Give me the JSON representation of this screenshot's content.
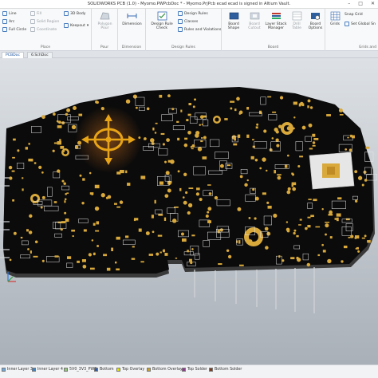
{
  "window": {
    "title": "SOLIDWORKS PCB (1.0) - Myomo.PWPcbDoc * - Myomo.PrjPcb ecad ecad is signed in Altium Vault.",
    "controls": [
      "–",
      "□",
      "✕"
    ]
  },
  "ribbon": {
    "place": {
      "label": "Place",
      "items": [
        "Line",
        "Arc",
        "Full Circle",
        "Fill",
        "Solid Region",
        "Coordinate",
        "Keepout",
        "3D Body"
      ]
    },
    "pour": {
      "label": "Pour",
      "polygon_pour": "Polygon Pour"
    },
    "dimension": {
      "label": "Dimension",
      "dimension": "Dimension"
    },
    "design_rules": {
      "label": "Design Rules",
      "design_rule_check": "Design Rule Check",
      "items": [
        "Design Rules",
        "Classes",
        "Rules and Violations"
      ]
    },
    "board": {
      "label": "Board",
      "buttons": [
        "Board Shape",
        "Board Cutout",
        "Layer Stack Manager",
        "Drill Table",
        "Board Options"
      ]
    },
    "grids": {
      "label": "Grids and",
      "grids_button": "Grids",
      "items": [
        "Snap Grid",
        "Set Global Sn"
      ]
    }
  },
  "tabs": [
    "PCBDoc",
    "6.SchDoc"
  ],
  "layers": [
    {
      "name": "Inner Layer 3",
      "color": "#6fa8dc"
    },
    {
      "name": "Inner Layer 4",
      "color": "#3d85c6"
    },
    {
      "name": "5V0_3V3_PWR",
      "color": "#93c47d"
    },
    {
      "name": "Bottom",
      "color": "#2f5ba8"
    },
    {
      "name": "Top Overlay",
      "color": "#e6e600"
    },
    {
      "name": "Bottom Overlay",
      "color": "#c9a227"
    },
    {
      "name": "Top Solder",
      "color": "#8e3b8f"
    },
    {
      "name": "Bottom Solder",
      "color": "#7a3d1f"
    }
  ],
  "colors": {
    "board": "#0b0b0b",
    "copper_pad": "#d9a93b",
    "silkscreen": "#e8e8e8",
    "canvas_top": "#d9dde2",
    "canvas_bottom": "#aeb5bd",
    "gizmo": "#e8a417"
  }
}
